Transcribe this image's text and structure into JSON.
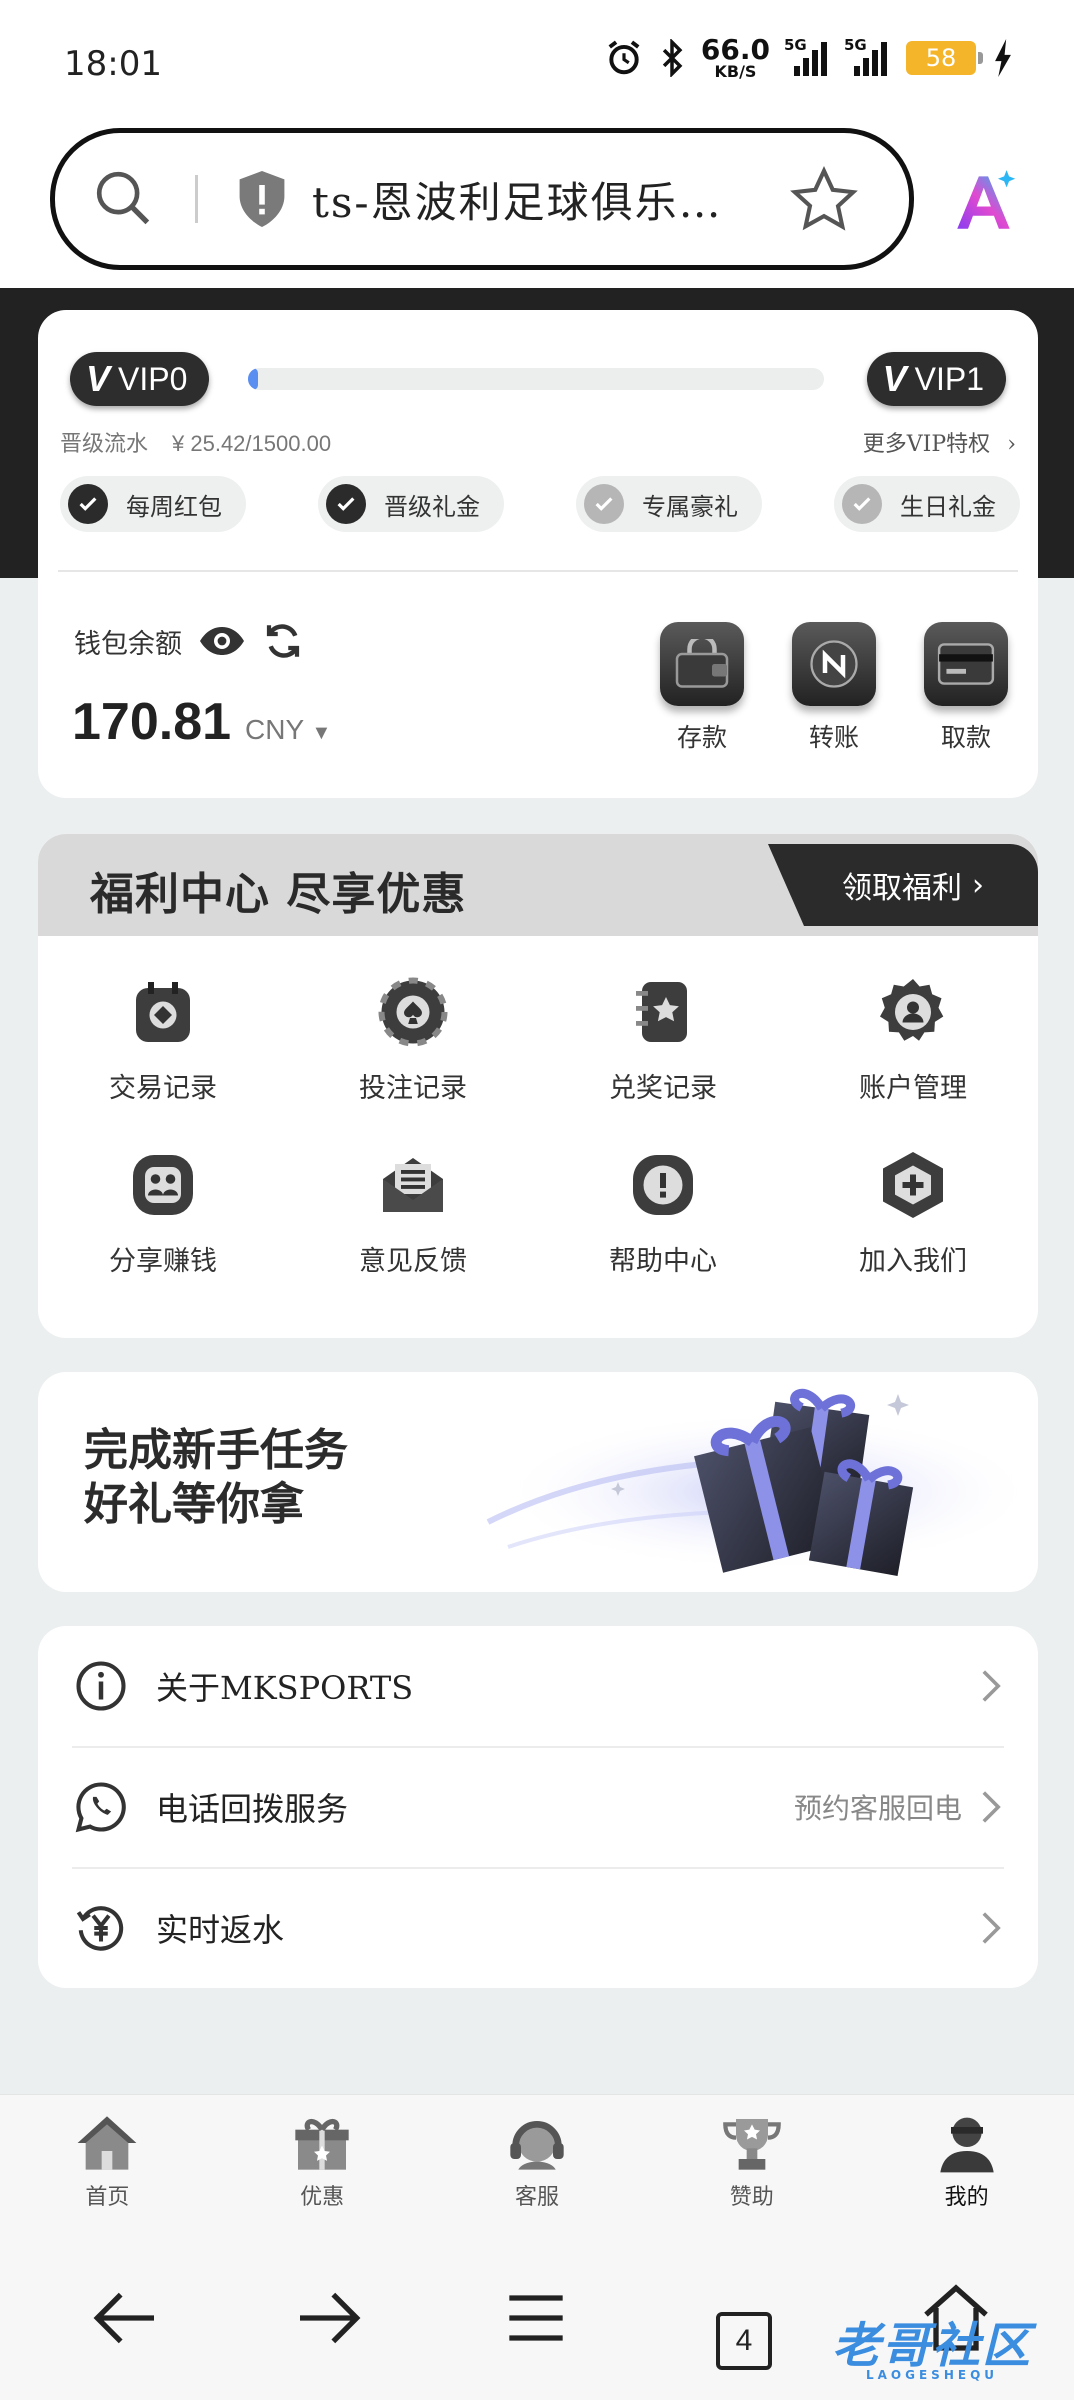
{
  "status_bar": {
    "time": "18:01",
    "net_speed": "66.0",
    "net_unit": "KB/S",
    "signal1": "5G",
    "signal2": "5G",
    "battery": "58"
  },
  "browser": {
    "url_text": "ts-恩波利足球俱乐…",
    "tab_count": "4"
  },
  "vip": {
    "current_level": "VIP0",
    "next_level": "VIP1",
    "progress": 0.017,
    "flow_label": "晋级流水",
    "flow_amount": "¥ 25.42/1500.00",
    "more_label": "更多VIP特权",
    "perks": [
      {
        "label": "每周红包",
        "unlocked": true
      },
      {
        "label": "晋级礼金",
        "unlocked": true
      },
      {
        "label": "专属豪礼",
        "unlocked": false
      },
      {
        "label": "生日礼金",
        "unlocked": false
      }
    ]
  },
  "wallet": {
    "label": "钱包余额",
    "amount": "170.81",
    "currency": "CNY",
    "actions": [
      "存款",
      "转账",
      "取款"
    ]
  },
  "welfare": {
    "title": "福利中心 尽享优惠",
    "button_label": "领取福利",
    "items": [
      "交易记录",
      "投注记录",
      "兑奖记录",
      "账户管理",
      "分享赚钱",
      "意见反馈",
      "帮助中心",
      "加入我们"
    ]
  },
  "banner": {
    "line1": "完成新手任务",
    "line2": "好礼等你拿"
  },
  "list": [
    {
      "label": "关于MKSPORTS",
      "hint": ""
    },
    {
      "label": "电话回拨服务",
      "hint": "预约客服回电"
    },
    {
      "label": "实时返水",
      "hint": ""
    }
  ],
  "tabs": [
    {
      "label": "首页"
    },
    {
      "label": "优惠"
    },
    {
      "label": "客服"
    },
    {
      "label": "赞助"
    },
    {
      "label": "我的"
    }
  ],
  "watermark": {
    "text": "老哥社区",
    "sub": "LAOGESHEQU"
  },
  "colors": {
    "dark": "#222222",
    "accent_progress": "#5a8ef0",
    "card_bg": "#ffffff",
    "page_bg": "#eceff0",
    "battery": "#f5b52a",
    "watermark": "#3b8de0"
  }
}
